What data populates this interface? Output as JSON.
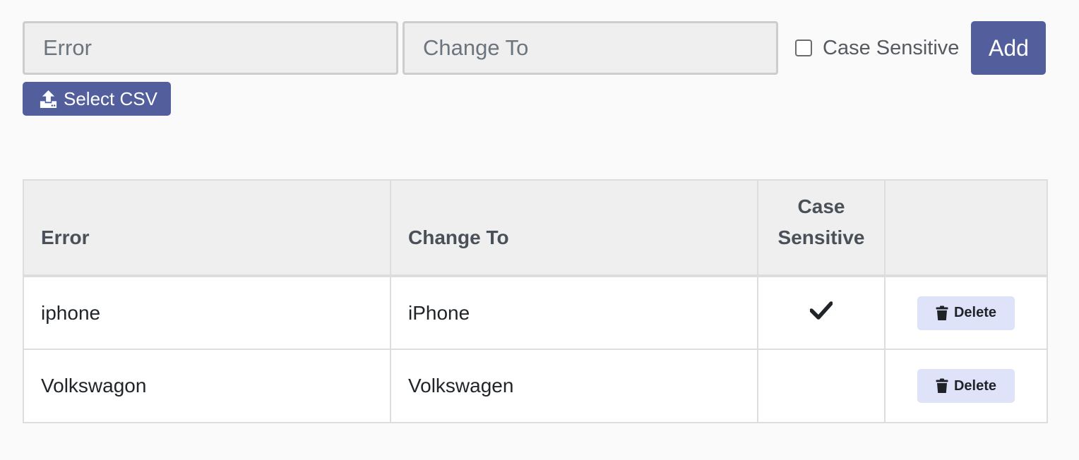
{
  "form": {
    "error_placeholder": "Error",
    "change_placeholder": "Change To",
    "case_sensitive_label": "Case Sensitive",
    "case_sensitive_checked": false,
    "add_label": "Add",
    "csv_label": "Select CSV",
    "csv_icon": "upload-icon"
  },
  "table": {
    "headers": {
      "error": "Error",
      "change_to": "Change To",
      "case_sensitive": "Case Sensitive",
      "actions": ""
    },
    "rows": [
      {
        "error": "iphone",
        "change_to": "iPhone",
        "case_sensitive": true,
        "delete_label": "Delete"
      },
      {
        "error": "Volkswagon",
        "change_to": "Volkswagen",
        "case_sensitive": false,
        "delete_label": "Delete"
      }
    ]
  },
  "colors": {
    "primary": "#525f9c",
    "delete_bg": "#dfe3f9",
    "header_bg": "#efefef"
  }
}
